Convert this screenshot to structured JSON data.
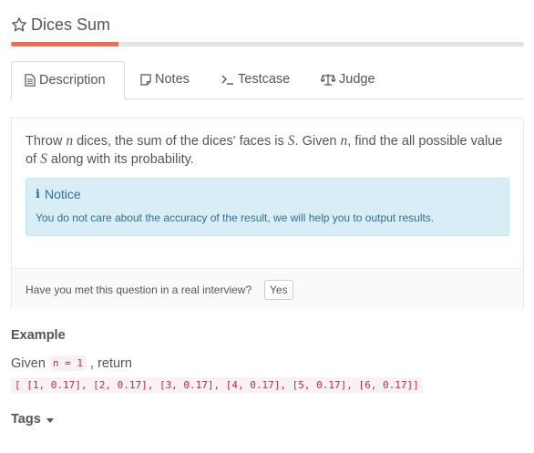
{
  "problem": {
    "title": "Dices Sum",
    "progress": 0.21
  },
  "tabs": [
    {
      "label": "Description",
      "icon": "file-text-icon"
    },
    {
      "label": "Notes",
      "icon": "note-icon"
    },
    {
      "label": "Testcase",
      "icon": "terminal-icon"
    },
    {
      "label": "Judge",
      "icon": "balance-scale-icon"
    }
  ],
  "description": {
    "t1": "Throw ",
    "var_n": "n",
    "t2": " dices, the sum of the dices' faces is ",
    "var_S": "S",
    "t3": ". Given ",
    "var_n2": "n",
    "t4": ", find the all possible value of ",
    "var_S2": "S",
    "t5": " along with its probability."
  },
  "notice": {
    "heading": "Notice",
    "body": "You do not care about the accuracy of the result, we will help you to output results."
  },
  "interview": {
    "question": "Have you met this question in a real interview?",
    "yes_label": "Yes"
  },
  "example": {
    "heading": "Example",
    "given_label": "Given",
    "given_code": "n = 1",
    "return_label": ", return",
    "result_code": "[ [1, 0.17], [2, 0.17], [3, 0.17], [4, 0.17], [5, 0.17], [6, 0.17]]"
  },
  "tags": {
    "label": "Tags"
  },
  "colors": {
    "accent": "#ee6d59",
    "notice_bg": "#d9edf7",
    "notice_text": "#31708f",
    "code_text": "#c7254e"
  }
}
